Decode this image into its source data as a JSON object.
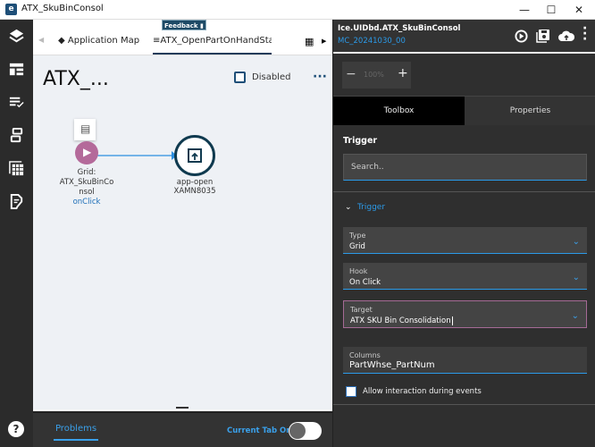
{
  "window": {
    "title": "ATX_SkuBinConsol",
    "logo": "e"
  },
  "sidebar": {
    "icons": [
      "layers-icon",
      "layout-icon",
      "list-check-icon",
      "transfer-icon",
      "grid-icon",
      "document-edit-icon"
    ],
    "help": "help-icon"
  },
  "feedback": {
    "label": "Feedback"
  },
  "tabs": [
    {
      "label": "Application Map"
    },
    {
      "label": "ATX_OpenPartOnHandStatus",
      "active": true
    }
  ],
  "canvas": {
    "title": "ATX_...",
    "disabled_label": "Disabled",
    "disabled_checked": false,
    "nodes": [
      {
        "label_lines": [
          "Grid:",
          "ATX_SkuBinCo",
          "nsol"
        ],
        "event": "onClick"
      },
      {
        "label": "app-open",
        "sub": "XAMN8035"
      }
    ]
  },
  "bottom": {
    "problems_tab": "Problems",
    "current_tab_only": "Current Tab Only",
    "toggle_on": false
  },
  "right": {
    "header_title": "Ice.UIDbd.ATX_SkuBinConsol",
    "header_sub": "MC_20241030_00",
    "zoom": "100%",
    "tabs": [
      "Toolbox",
      "Properties"
    ],
    "section_title": "Trigger",
    "search_placeholder": "Search..",
    "group": "Trigger",
    "fields": [
      {
        "label": "Type",
        "value": "Grid"
      },
      {
        "label": "Hook",
        "value": "On Click"
      },
      {
        "label": "Target",
        "value": "ATX SKU Bin Consolidation"
      }
    ],
    "columns": {
      "label": "Columns",
      "value": "PartWhse_PartNum"
    },
    "allow_label": "Allow interaction during events",
    "allow_checked": false
  },
  "colors": {
    "accent": "#2b9ae8",
    "trigger_node": "#b46a9a",
    "action_node": "#0f3a4f",
    "dark_panel": "#2f2f2f"
  }
}
